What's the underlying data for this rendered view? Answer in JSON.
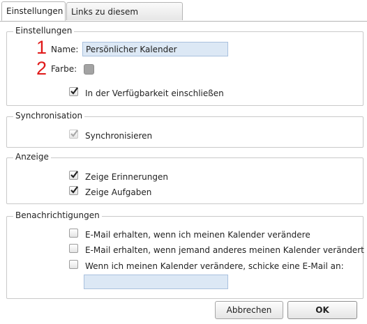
{
  "tabs": [
    {
      "label": "Einstellungen",
      "active": true
    },
    {
      "label": "Links zu diesem Kalender",
      "active": false
    }
  ],
  "annotations": [
    "1",
    "2"
  ],
  "settings": {
    "legend": "Einstellungen",
    "name_label": "Name:",
    "name_value": "Persönlicher Kalender",
    "color_label": "Farbe:",
    "color_value": "#a3a3a3",
    "availability_label": "In der Verfügbarkeit einschließen",
    "availability_checked": true
  },
  "sync": {
    "legend": "Synchronisation",
    "sync_label": "Synchronisieren",
    "sync_checked": true,
    "sync_disabled": true
  },
  "display": {
    "legend": "Anzeige",
    "reminders_label": "Zeige Erinnerungen",
    "reminders_checked": true,
    "tasks_label": "Zeige Aufgaben",
    "tasks_checked": true
  },
  "notifications": {
    "legend": "Benachrichtigungen",
    "self_change_label": "E-Mail erhalten, wenn ich meinen Kalender verändere",
    "self_change_checked": false,
    "other_change_label": "E-Mail erhalten, wenn jemand anderes meinen Kalender verändert",
    "other_change_checked": false,
    "send_mail_label": "Wenn ich meinen Kalender verändere, schicke eine E-Mail an:",
    "send_mail_checked": false,
    "email_value": ""
  },
  "buttons": {
    "cancel": "Abbrechen",
    "ok": "OK"
  },
  "colors": {
    "accent_red": "#e01a1a",
    "input_bg": "#dce8f5"
  }
}
